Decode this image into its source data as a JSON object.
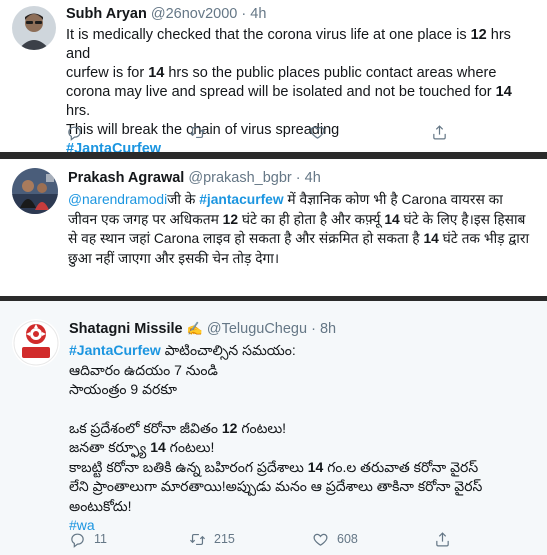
{
  "tweets": [
    {
      "name": "Subh Aryan",
      "handle": "@26nov2000",
      "time": "4h",
      "lines": [
        [
          "It is medically checked that the corona virus life at one place is ",
          "12",
          " hrs and"
        ],
        [
          "curfew is for ",
          "14",
          " hrs so the public places public contact areas where"
        ],
        [
          "corona may live and spread will be isolated and not be touched for ",
          "14",
          " hrs."
        ],
        [
          "This will break the chain of virus spreading"
        ]
      ],
      "hashtag": "#JantaCurfew"
    },
    {
      "name": "Prakash Agrawal",
      "handle": "@prakash_bgbr",
      "time": "4h",
      "mention": "@narendramodi",
      "line1_a": "जी के ",
      "hashtag": "#jantacurfew",
      "line1_b": " में वैज्ञानिक कोण भी है Carona वायरस का",
      "line2_a": "जीवन एक जगह पर अधिकतम ",
      "line2_num": "12",
      "line2_b": " घंटे का ही होता है और कर्फ़्यू ",
      "line2_num2": "14",
      "line2_c": " घंटे के लिए है।इस हिसाब",
      "line3_a": "से वह स्थान जहां Carona लाइव हो सकता है और संक्रमित हो सकता है ",
      "line3_num": "14",
      "line3_b": " घंटे तक भीड़ द्वारा",
      "line4": "छुआ नहीं जाएगा और इसकी चेन तोड़ देगा।"
    },
    {
      "name": "Shatagni Missile",
      "badge": "✍️",
      "handle": "@TeluguChegu",
      "time": "8h",
      "logo_text": "TELUGU CHEGU",
      "hashtag": "#JantaCurfew",
      "line1_rest": " పాటించాల్సిన సమయం:",
      "line2": "ఆదివారం ఉదయం 7 నుండి",
      "line3": "సాయంత్రం 9 వరకూ",
      "line4_a": "ఒక ప్రదేశంలో కరోనా జీవితం ",
      "line4_num": "12",
      "line4_b": " గంటలు!",
      "line5_a": "జనతా కర్ఫ్యూ ",
      "line5_num": "14",
      "line5_b": " గంటలు!",
      "line6_a": "కాబట్టి కరోనా బతికి ఉన్న బహిరంగ ప్రదేశాలు ",
      "line6_num": "14",
      "line6_b": " గం.ల తరువాత కరోనా వైరస్",
      "line7": "లేని ప్రాంతాలుగా మారతాయి!అప్పుడు మనం ఆ ప్రదేశాలు తాకినా కరోనా వైరస్",
      "line8": "అంటుకోదు!",
      "tag2": "#wa",
      "reply_count": "11",
      "retweet_count": "215",
      "like_count": "608"
    }
  ],
  "icons": [
    "reply-icon",
    "retweet-icon",
    "like-icon",
    "share-icon"
  ],
  "colors": {
    "link": "#1b95e0",
    "meta": "#657786",
    "text": "#14171a",
    "separator": "#2b2b2b"
  }
}
